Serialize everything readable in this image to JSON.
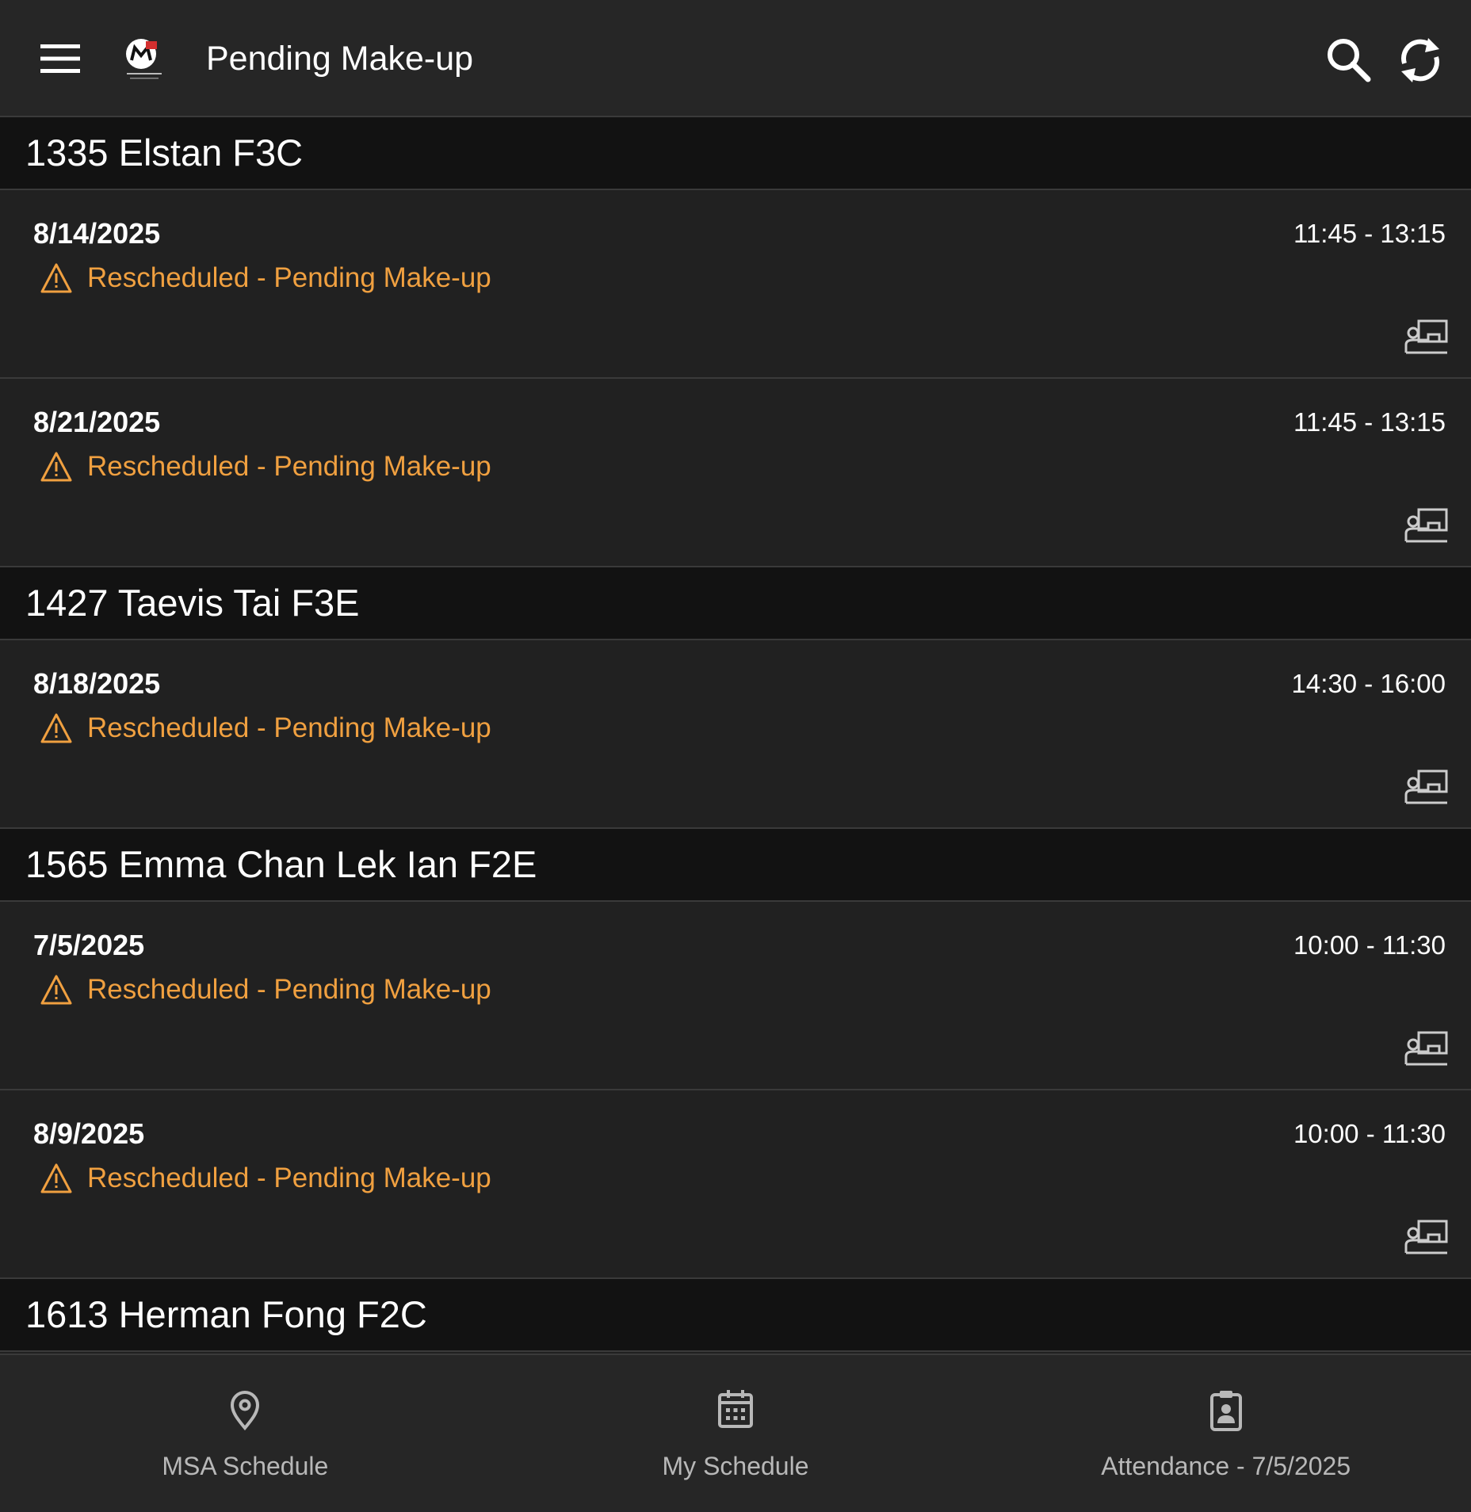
{
  "appbar": {
    "title": "Pending Make-up",
    "icons": {
      "menu": "menu-icon",
      "logo": "app-logo",
      "search": "search-icon",
      "refresh": "refresh-icon"
    }
  },
  "colors": {
    "background": "#212121",
    "header_bg": "#121212",
    "status": "#f0a040",
    "nav_text": "#b8b8b8"
  },
  "groups": [
    {
      "header": "1335 Elstan F3C",
      "items": [
        {
          "date": "8/14/2025",
          "time": "11:45 - 13:15",
          "status": "Rescheduled - Pending Make-up"
        },
        {
          "date": "8/21/2025",
          "time": "11:45 - 13:15",
          "status": "Rescheduled - Pending Make-up"
        }
      ]
    },
    {
      "header": "1427 Taevis Tai F3E",
      "items": [
        {
          "date": "8/18/2025",
          "time": "14:30 - 16:00",
          "status": "Rescheduled - Pending Make-up"
        }
      ]
    },
    {
      "header": "1565 Emma Chan Lek Ian F2E",
      "items": [
        {
          "date": "7/5/2025",
          "time": "10:00 - 11:30",
          "status": "Rescheduled - Pending Make-up"
        },
        {
          "date": "8/9/2025",
          "time": "10:00 - 11:30",
          "status": "Rescheduled - Pending Make-up"
        }
      ]
    },
    {
      "header": "1613 Herman Fong F2C",
      "items": []
    }
  ],
  "bottom_nav": [
    {
      "label": "MSA Schedule",
      "icon": "location-pin-icon"
    },
    {
      "label": "My Schedule",
      "icon": "calendar-icon"
    },
    {
      "label": "Attendance - 7/5/2025",
      "icon": "clipboard-user-icon"
    }
  ]
}
